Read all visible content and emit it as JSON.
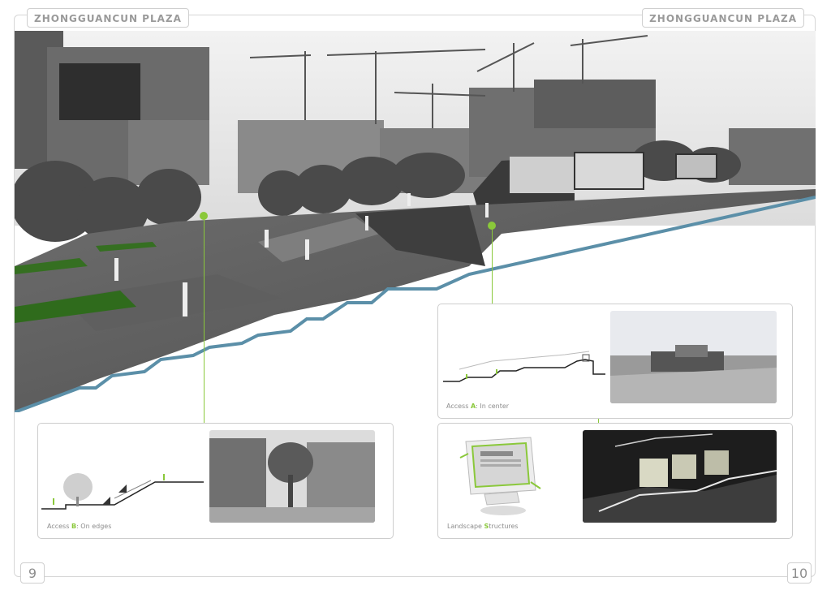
{
  "header": {
    "left_title": "ZHONGGUANCUN PLAZA",
    "right_title": "ZHONGGUANCUN PLAZA"
  },
  "footer": {
    "left_page": "9",
    "right_page": "10"
  },
  "panels": {
    "access_a": {
      "prefix": "Access ",
      "highlight": "A",
      "suffix": ": In center"
    },
    "access_b": {
      "prefix": "Access ",
      "highlight": "B",
      "suffix": ": On edges"
    },
    "structures": {
      "prefix": "Landscape ",
      "highlight": "S",
      "suffix": "tructures"
    }
  },
  "colors": {
    "accent": "#8ac83a",
    "frame": "#d6d6d6",
    "label": "#8c8c8c"
  }
}
